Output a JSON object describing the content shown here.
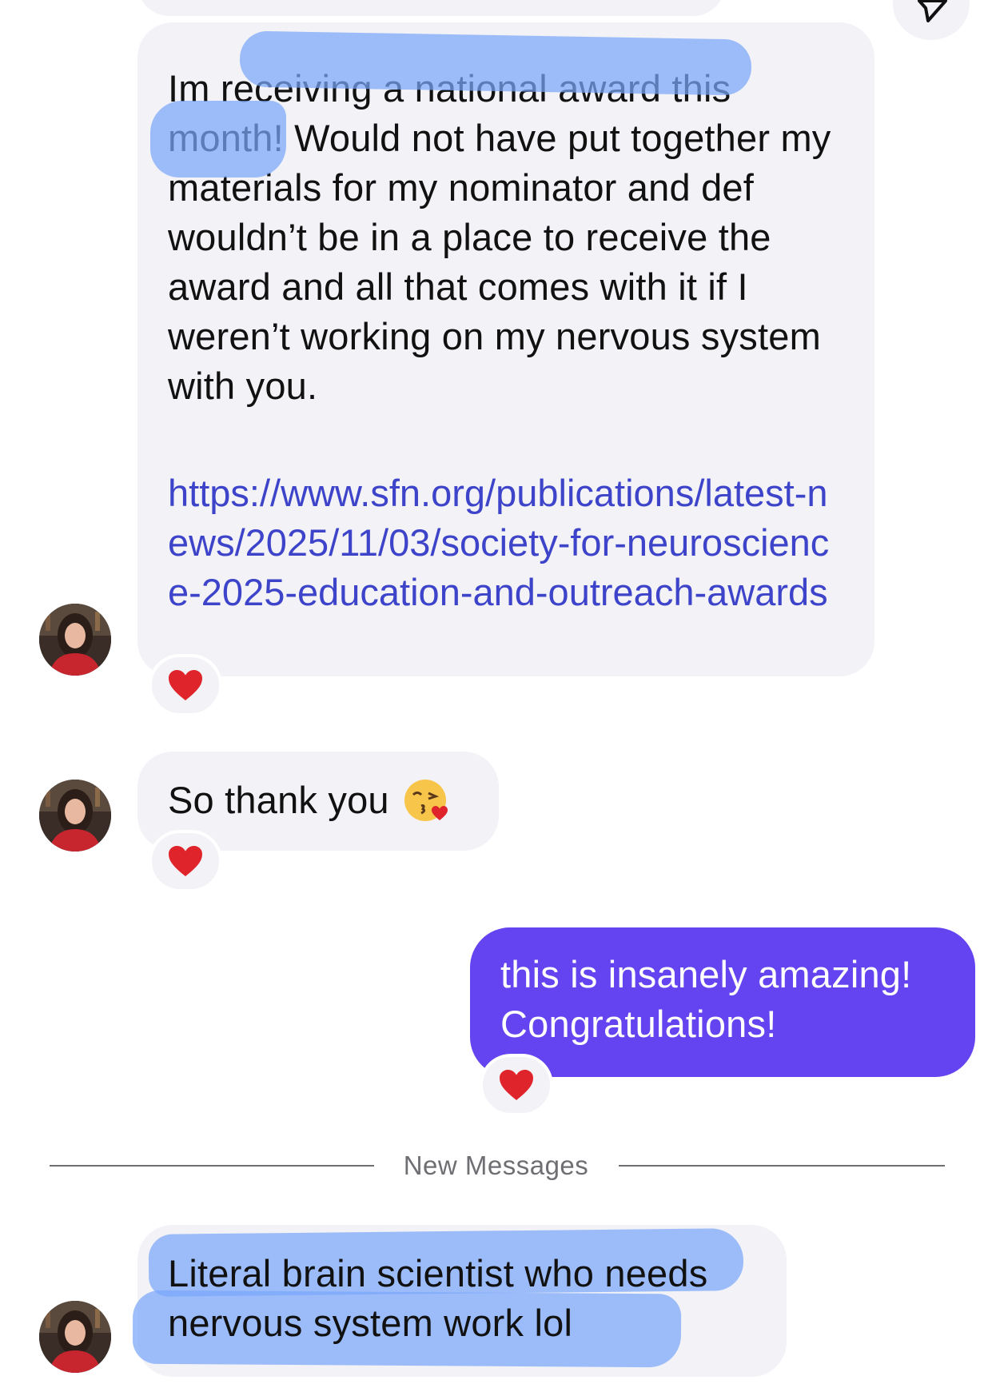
{
  "messages": [
    {
      "id": "msg-award",
      "direction": "incoming",
      "text": "Im receiving a national award this month! Would not have put together my materials for my nominator and def wouldn’t be in a place to receive the award and all that comes with it if I weren’t working on my nervous system with you.",
      "link": "https://www.sfn.org/publications/latest-news/2025/11/03/society-for-neuroscience-2025-education-and-outreach-awards",
      "reaction": "heart-emoji"
    },
    {
      "id": "msg-thanks",
      "direction": "incoming",
      "text": "So thank you",
      "emoji": "face-blowing-a-kiss-emoji",
      "reaction": "heart-emoji"
    },
    {
      "id": "msg-reply",
      "direction": "outgoing",
      "text": "this is insanely amazing! Congratulations!",
      "reaction": "heart-emoji"
    },
    {
      "id": "msg-brain",
      "direction": "incoming",
      "text": "Literal brain scientist who needs nervous system work lol"
    }
  ],
  "divider": {
    "label": "New Messages"
  },
  "colors": {
    "incoming_bubble": "#f2f2f7",
    "outgoing_bubble": "#6443f0",
    "link": "#3d44c9",
    "highlight": "#7aa6fa",
    "reaction_heart": "#e0242b"
  },
  "icons": {
    "share": "send-arrow-icon",
    "avatar": "contact-avatar-photo"
  }
}
